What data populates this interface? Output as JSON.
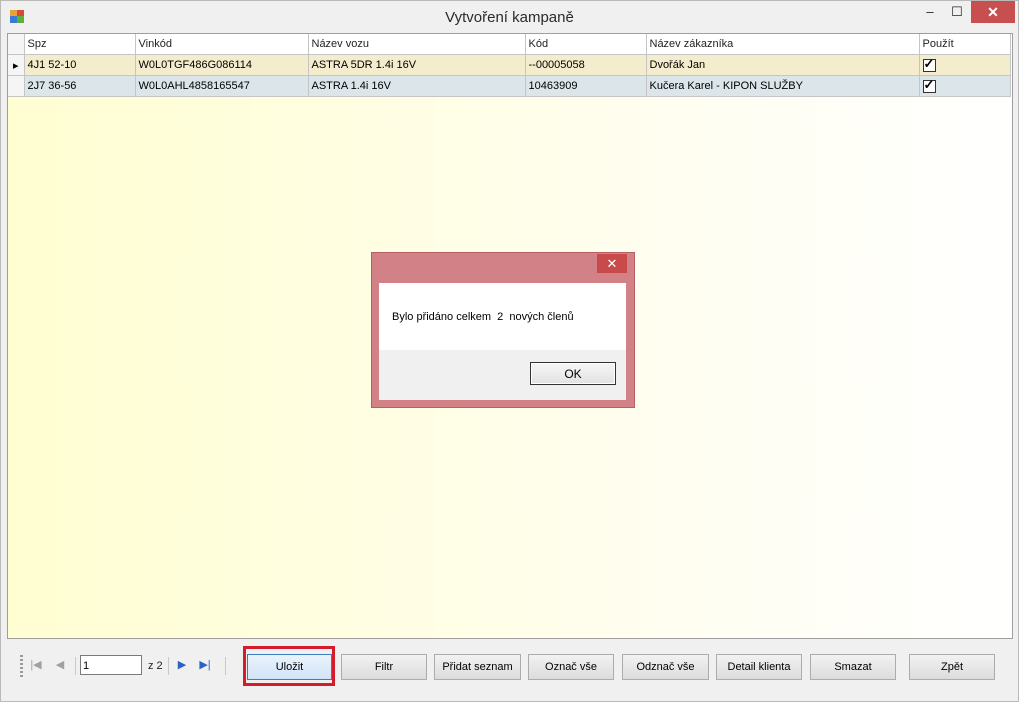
{
  "window": {
    "title": "Vytvoření kampaně",
    "min_glyph": "–",
    "max_glyph": "☐",
    "close_glyph": "✕"
  },
  "grid": {
    "columns": [
      "Spz",
      "Vinkód",
      "Název vozu",
      "Kód",
      "Název zákazníka",
      "Použít"
    ],
    "current_row_glyph": "▸",
    "rows": [
      {
        "spz": "4J1 52-10",
        "vin": "W0L0TGF486G086114",
        "car": "ASTRA 5DR 1.4i 16V",
        "code": "--00005058",
        "customer": "Dvořák Jan",
        "use": true
      },
      {
        "spz": "2J7 36-56",
        "vin": "W0L0AHL4858165547",
        "car": "ASTRA 1.4i 16V",
        "code": "10463909",
        "customer": "Kučera Karel - KIPON SLUŽBY",
        "use": true
      }
    ]
  },
  "dialog": {
    "message": "Bylo přidáno celkem  2  nových členů",
    "ok_label": "OK",
    "close_glyph": "✕"
  },
  "pager": {
    "first_glyph": "|◀",
    "prev_glyph": "◀",
    "next_glyph": "▶",
    "last_glyph": "▶|",
    "page_value": "1",
    "of_text": "z 2"
  },
  "buttons": {
    "save": "Uložit",
    "filter": "Filtr",
    "add_list": "Přidat seznam",
    "select_all": "Označ vše",
    "deselect_all": "Odznač vše",
    "client_detail": "Detail klienta",
    "delete": "Smazat",
    "back": "Zpět"
  },
  "colors": {
    "highlight": "#d51c2a",
    "dialog_frame": "#d28186",
    "close_red": "#c7504f"
  }
}
